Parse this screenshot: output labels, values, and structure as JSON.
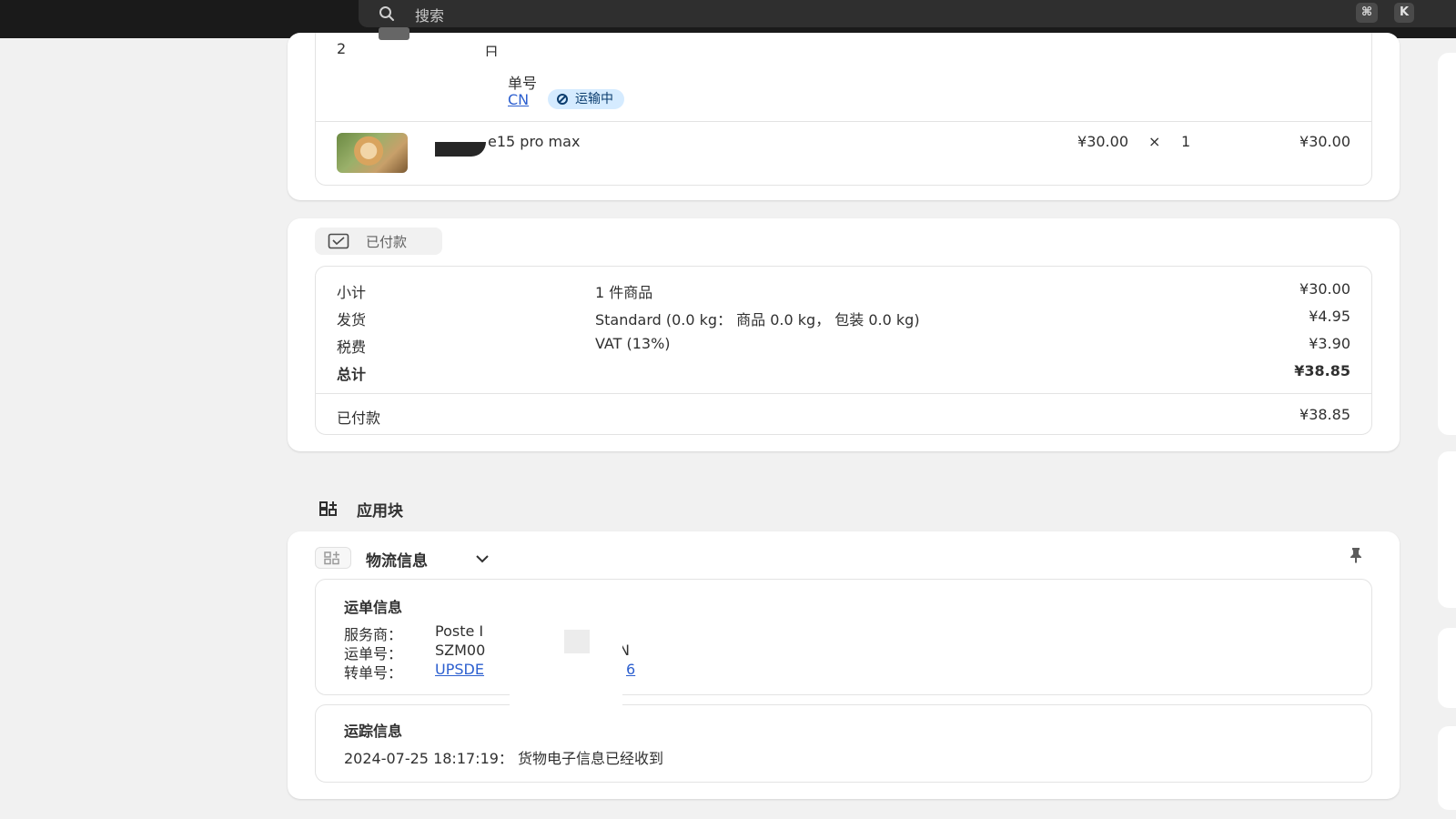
{
  "search": {
    "placeholder": "搜索",
    "shortcut_mod": "⌘",
    "shortcut_key": "K"
  },
  "fulfillment": {
    "date_fragment_start": "2",
    "date_fragment_end": "日",
    "tracking_label_fragment": "单号",
    "tracking_link_fragment": "CN",
    "status_badge": "运输中",
    "item": {
      "name_fragment": "e15 pro max",
      "unit_price": "¥30.00",
      "times": "×",
      "quantity": "1",
      "total": "¥30.00"
    }
  },
  "payment": {
    "status": "已付款",
    "rows": [
      {
        "label": "小计",
        "detail": "1 件商品",
        "amount": "¥30.00"
      },
      {
        "label": "发货",
        "detail": "Standard (0.0 kg： 商品 0.0 kg， 包装 0.0 kg)",
        "amount": "¥4.95"
      },
      {
        "label": "税费",
        "detail": "VAT (13%)",
        "amount": "¥3.90"
      },
      {
        "label": "总计",
        "detail": "",
        "amount": "¥38.85"
      }
    ],
    "paid_label": "已付款",
    "paid_amount": "¥38.85"
  },
  "app_blocks": {
    "title": "应用块",
    "logistics": {
      "title": "物流信息",
      "waybill": {
        "heading": "运单信息",
        "carrier_label": "服务商：",
        "carrier_value": "Poste I",
        "waybill_label": "运单号：",
        "waybill_value": "SZM00",
        "waybill_suffix": "N",
        "transfer_label": "转单号：",
        "transfer_value": "UPSDE",
        "transfer_suffix": "6"
      },
      "tracking": {
        "heading": "运踪信息",
        "event": "2024-07-25 18:17:19： 货物电子信息已经收到"
      }
    }
  },
  "colors": {
    "badge_bg": "#d5ebff",
    "link": "#2c5fcf",
    "topbar": "#1a1a1a"
  }
}
